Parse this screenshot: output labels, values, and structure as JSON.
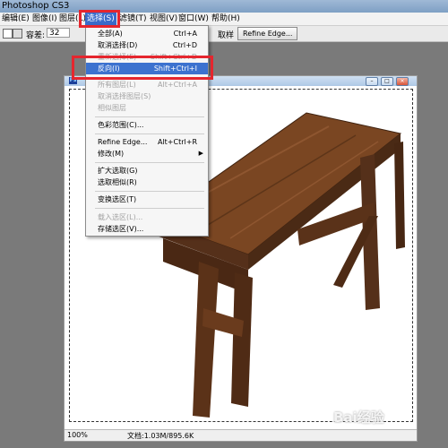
{
  "title": "Photoshop CS3",
  "menubar": {
    "items": [
      "编辑(E)",
      "图像(I)",
      "图层(L)",
      "选择(S)",
      "滤镜(T)",
      "视图(V)",
      "窗口(W)",
      "帮助(H)"
    ]
  },
  "options": {
    "tolerance_label": "容差:",
    "tolerance_value": "32",
    "sample_all": "取样",
    "refine_edge": "Refine Edge..."
  },
  "select_menu": {
    "items": [
      {
        "label": "全部(A)",
        "shortcut": "Ctrl+A",
        "enabled": true
      },
      {
        "label": "取消选择(D)",
        "shortcut": "Ctrl+D",
        "enabled": true
      },
      {
        "label": "重新选择(E)",
        "shortcut": "Shift+Ctrl+D",
        "enabled": false
      },
      {
        "label": "反向(I)",
        "shortcut": "Shift+Ctrl+I",
        "enabled": true,
        "highlighted": true
      },
      {
        "label": "所有图层(L)",
        "shortcut": "Alt+Ctrl+A",
        "enabled": false
      },
      {
        "label": "取消选择图层(S)",
        "shortcut": "",
        "enabled": false
      },
      {
        "label": "相似图层",
        "shortcut": "",
        "enabled": false
      },
      {
        "label": "色彩范围(C)...",
        "shortcut": "",
        "enabled": true
      },
      {
        "label": "Refine Edge...",
        "shortcut": "Alt+Ctrl+R",
        "enabled": true
      },
      {
        "label": "修改(M)",
        "shortcut": "",
        "enabled": true,
        "submenu": true
      },
      {
        "label": "扩大选取(G)",
        "shortcut": "",
        "enabled": true
      },
      {
        "label": "选取相似(R)",
        "shortcut": "",
        "enabled": true
      },
      {
        "label": "变换选区(T)",
        "shortcut": "",
        "enabled": true
      },
      {
        "label": "载入选区(L)...",
        "shortcut": "",
        "enabled": false
      },
      {
        "label": "存储选区(V)...",
        "shortcut": "",
        "enabled": true
      }
    ]
  },
  "document": {
    "zoom": "100%",
    "info": "文档:1.03M/895.6K"
  },
  "watermark": "Bai经验",
  "colors": {
    "highlight": "#3c72cf",
    "annotation_red": "#e5262e",
    "bench_wood": "#6b3d1c"
  }
}
